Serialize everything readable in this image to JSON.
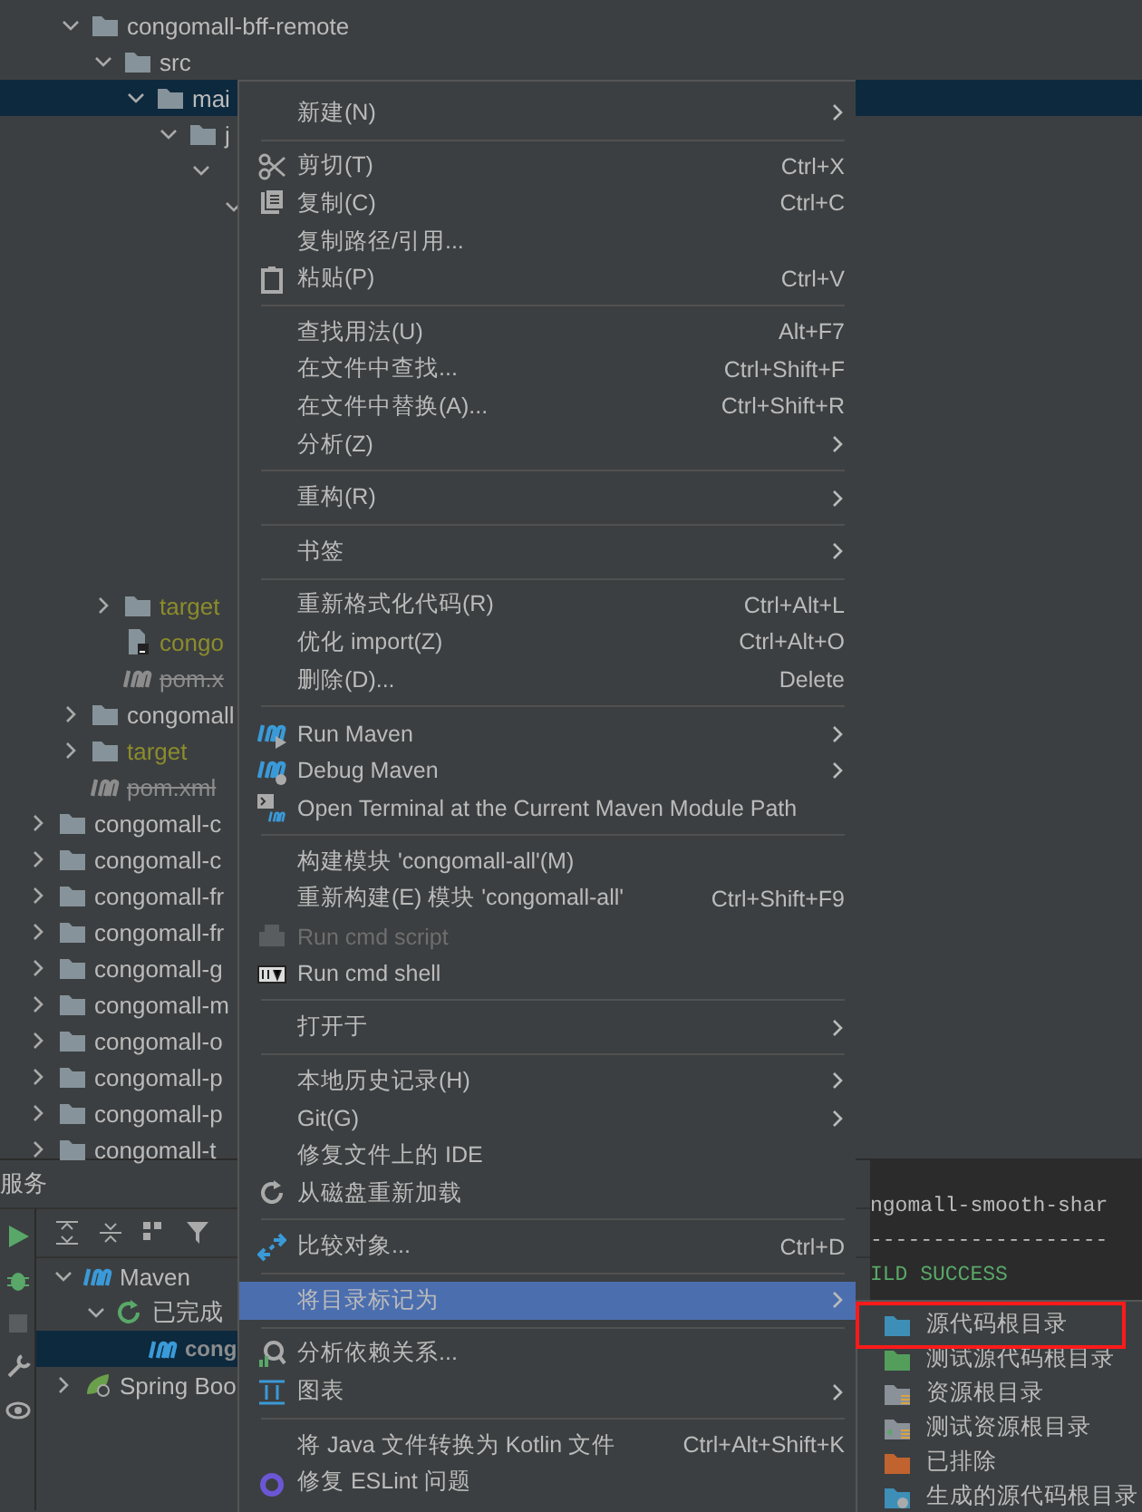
{
  "project_tree": {
    "nested_items": [
      {
        "name": "congomall-bff-remote",
        "kind": "folder",
        "expanded": true,
        "selected": false,
        "children": [
          {
            "name": "src",
            "kind": "folder",
            "expanded": true,
            "selected": false,
            "children": [
              {
                "name": "mai",
                "kind": "folder",
                "expanded": true,
                "selected": true,
                "children": [
                  {
                    "name": "j",
                    "kind": "folder",
                    "expanded": true,
                    "selected": false,
                    "children": [
                      {
                        "expanded": true,
                        "children": [
                          {
                            "expanded": true
                          }
                        ]
                      }
                    ]
                  }
                ]
              }
            ]
          },
          {
            "name": "target",
            "kind": "excluded",
            "expanded": false,
            "selected": false
          },
          {
            "name": "congo",
            "kind": "file",
            "selected": false
          },
          {
            "name": "pom.x",
            "kind": "maven",
            "selected": false
          }
        ]
      },
      {
        "name": "congomall",
        "kind": "folder",
        "expanded": false,
        "selected": false
      },
      {
        "name": "target",
        "kind": "excluded",
        "expanded": false,
        "selected": false
      },
      {
        "name": "pom.xml",
        "kind": "maven",
        "selected": false
      }
    ],
    "modules": [
      {
        "name": "congomall-c",
        "expanded": false
      },
      {
        "name": "congomall-c",
        "expanded": false
      },
      {
        "name": "congomall-fr",
        "expanded": false
      },
      {
        "name": "congomall-fr",
        "expanded": false
      },
      {
        "name": "congomall-g",
        "expanded": false
      },
      {
        "name": "congomall-m",
        "expanded": false
      },
      {
        "name": "congomall-o",
        "expanded": false
      },
      {
        "name": "congomall-p",
        "expanded": false
      },
      {
        "name": "congomall-p",
        "expanded": false
      },
      {
        "name": "congomall-t",
        "expanded": false
      }
    ]
  },
  "services": {
    "title": "服务",
    "tree": [
      {
        "name": "Maven",
        "kind": "maven",
        "expanded": true,
        "selected": false,
        "children": [
          {
            "name": "已完成",
            "kind": "done",
            "expanded": true,
            "selected": false,
            "children": [
              {
                "name": "cong",
                "kind": "maven",
                "selected": true
              }
            ]
          }
        ]
      },
      {
        "name": "Spring Boo",
        "kind": "spring",
        "expanded": false,
        "selected": false
      }
    ],
    "console": [
      "ngomall-smooth-shar",
      "-------------------",
      "ILD SUCCESS"
    ]
  },
  "context_menu": {
    "groups": [
      [
        {
          "label": "新建(N)",
          "submenu": true,
          "disabled": false,
          "selected": false
        }
      ],
      [
        {
          "label": "剪切(T)",
          "shortcut": "Ctrl+X",
          "submenu": false,
          "disabled": false,
          "selected": false
        },
        {
          "label": "复制(C)",
          "shortcut": "Ctrl+C",
          "submenu": false,
          "disabled": false,
          "selected": false
        },
        {
          "label": "复制路径/引用...",
          "submenu": false,
          "disabled": false,
          "selected": false
        },
        {
          "label": "粘贴(P)",
          "shortcut": "Ctrl+V",
          "submenu": false,
          "disabled": false,
          "selected": false
        }
      ],
      [
        {
          "label": "查找用法(U)",
          "shortcut": "Alt+F7",
          "submenu": false,
          "disabled": false,
          "selected": false
        },
        {
          "label": "在文件中查找...",
          "shortcut": "Ctrl+Shift+F",
          "submenu": false,
          "disabled": false,
          "selected": false
        },
        {
          "label": "在文件中替换(A)...",
          "shortcut": "Ctrl+Shift+R",
          "submenu": false,
          "disabled": false,
          "selected": false
        },
        {
          "label": "分析(Z)",
          "submenu": true,
          "disabled": false,
          "selected": false
        }
      ],
      [
        {
          "label": "重构(R)",
          "submenu": true,
          "disabled": false,
          "selected": false
        }
      ],
      [
        {
          "label": "书签",
          "submenu": true,
          "disabled": false,
          "selected": false
        }
      ],
      [
        {
          "label": "重新格式化代码(R)",
          "shortcut": "Ctrl+Alt+L",
          "submenu": false,
          "disabled": false,
          "selected": false
        },
        {
          "label": "优化 import(Z)",
          "shortcut": "Ctrl+Alt+O",
          "submenu": false,
          "disabled": false,
          "selected": false
        },
        {
          "label": "删除(D)...",
          "shortcut": "Delete",
          "submenu": false,
          "disabled": false,
          "selected": false
        }
      ],
      [
        {
          "label": "Run Maven",
          "submenu": true,
          "disabled": false,
          "selected": false
        },
        {
          "label": "Debug Maven",
          "submenu": true,
          "disabled": false,
          "selected": false
        },
        {
          "label": "Open Terminal at the Current Maven Module Path",
          "submenu": false,
          "disabled": false,
          "selected": false
        }
      ],
      [
        {
          "label": "构建模块 'congomall-all'(M)",
          "submenu": false,
          "disabled": false,
          "selected": false
        },
        {
          "label": "重新构建(E) 模块 'congomall-all'",
          "shortcut": "Ctrl+Shift+F9",
          "submenu": false,
          "disabled": false,
          "selected": false
        },
        {
          "label": "Run cmd script",
          "submenu": false,
          "disabled": true,
          "selected": false
        },
        {
          "label": "Run cmd shell",
          "submenu": false,
          "disabled": false,
          "selected": false
        }
      ],
      [
        {
          "label": "打开于",
          "submenu": true,
          "disabled": false,
          "selected": false
        }
      ],
      [
        {
          "label": "本地历史记录(H)",
          "submenu": true,
          "disabled": false,
          "selected": false
        },
        {
          "label": "Git(G)",
          "submenu": true,
          "disabled": false,
          "selected": false
        },
        {
          "label": "修复文件上的 IDE",
          "submenu": false,
          "disabled": false,
          "selected": false
        },
        {
          "label": "从磁盘重新加载",
          "submenu": false,
          "disabled": false,
          "selected": false
        }
      ],
      [
        {
          "label": "比较对象...",
          "shortcut": "Ctrl+D",
          "submenu": false,
          "disabled": false,
          "selected": false
        }
      ],
      [
        {
          "label": "将目录标记为",
          "submenu": true,
          "disabled": false,
          "selected": true
        }
      ],
      [
        {
          "label": "分析依赖关系...",
          "submenu": false,
          "disabled": false,
          "selected": false
        },
        {
          "label": "图表",
          "submenu": true,
          "disabled": false,
          "selected": false
        }
      ],
      [
        {
          "label": "将 Java 文件转换为 Kotlin 文件",
          "shortcut": "Ctrl+Alt+Shift+K",
          "submenu": false,
          "disabled": false,
          "selected": false
        },
        {
          "label": "修复 ESLint 问题",
          "submenu": false,
          "disabled": false,
          "selected": false
        }
      ]
    ]
  },
  "submenu": {
    "items": [
      {
        "label": "源代码根目录",
        "color": "#3d8fb8",
        "kind": "plain",
        "highlighted": true
      },
      {
        "label": "测试源代码根目录",
        "color": "#549e5b",
        "kind": "plain",
        "highlighted": false
      },
      {
        "label": "资源根目录",
        "color": "#8a9199",
        "kind": "resource",
        "highlighted": false
      },
      {
        "label": "测试资源根目录",
        "color": "#8a9199",
        "kind": "test-resource",
        "highlighted": false
      },
      {
        "label": "已排除",
        "color": "#c0632f",
        "kind": "plain",
        "highlighted": false
      },
      {
        "label": "生成的源代码根目录",
        "color": "#3d8fb8",
        "kind": "generated",
        "highlighted": false
      }
    ]
  }
}
